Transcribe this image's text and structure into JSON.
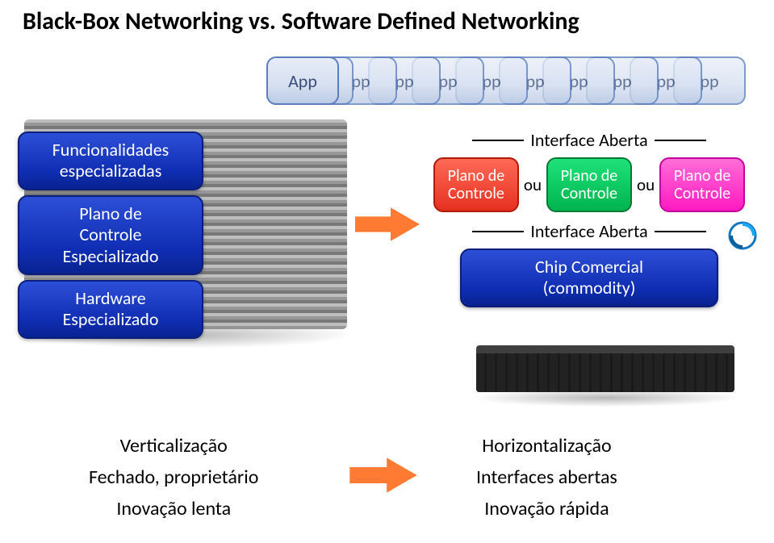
{
  "title": "Black-Box Networking vs. Software Defined Networking",
  "app": {
    "label": "App",
    "ghost": "pp"
  },
  "left": {
    "funcionalidades_l1": "Funcionalidades",
    "funcionalidades_l2": "especializadas",
    "plano1_l1": "Plano de",
    "plano1_l2": "Controle",
    "plano1_l3": "Especializado",
    "hw_l1": "Hardware",
    "hw_l2": "Especializado"
  },
  "right": {
    "iface_aberta": "Interface Aberta",
    "ou": "ou",
    "cp_l1": "Plano de",
    "cp_l2": "Controle",
    "chip_l1": "Chip Comercial",
    "chip_l2": "(commodity)"
  },
  "bottom": {
    "left1": "Verticalização",
    "left2": "Fechado, proprietário",
    "left3": "Inovação lenta",
    "right1": "Horizontalização",
    "right2": "Interfaces abertas",
    "right3": "Inovação rápida"
  },
  "colors": {
    "arrow": "#ff7a33",
    "blue": "#1633c0",
    "pink": "#ff19c1",
    "green": "#00b44e",
    "red": "#e6301f"
  },
  "chart_data": {
    "type": "table",
    "title": "Black-Box Networking vs. Software Defined Networking",
    "left_stack": [
      "Funcionalidades especializadas",
      "Plano de Controle Especializado",
      "Hardware Especializado"
    ],
    "right_stack": {
      "top_interface": "Interface Aberta",
      "control_plane_options": [
        "Plano de Controle",
        "Plano de Controle",
        "Plano de Controle"
      ],
      "connector": "ou",
      "mid_interface": "Interface Aberta",
      "bottom": "Chip Comercial (commodity)"
    },
    "left_properties": [
      "Verticalização",
      "Fechado, proprietário",
      "Inovação lenta"
    ],
    "right_properties": [
      "Horizontalização",
      "Interfaces abertas",
      "Inovação rápida"
    ]
  }
}
